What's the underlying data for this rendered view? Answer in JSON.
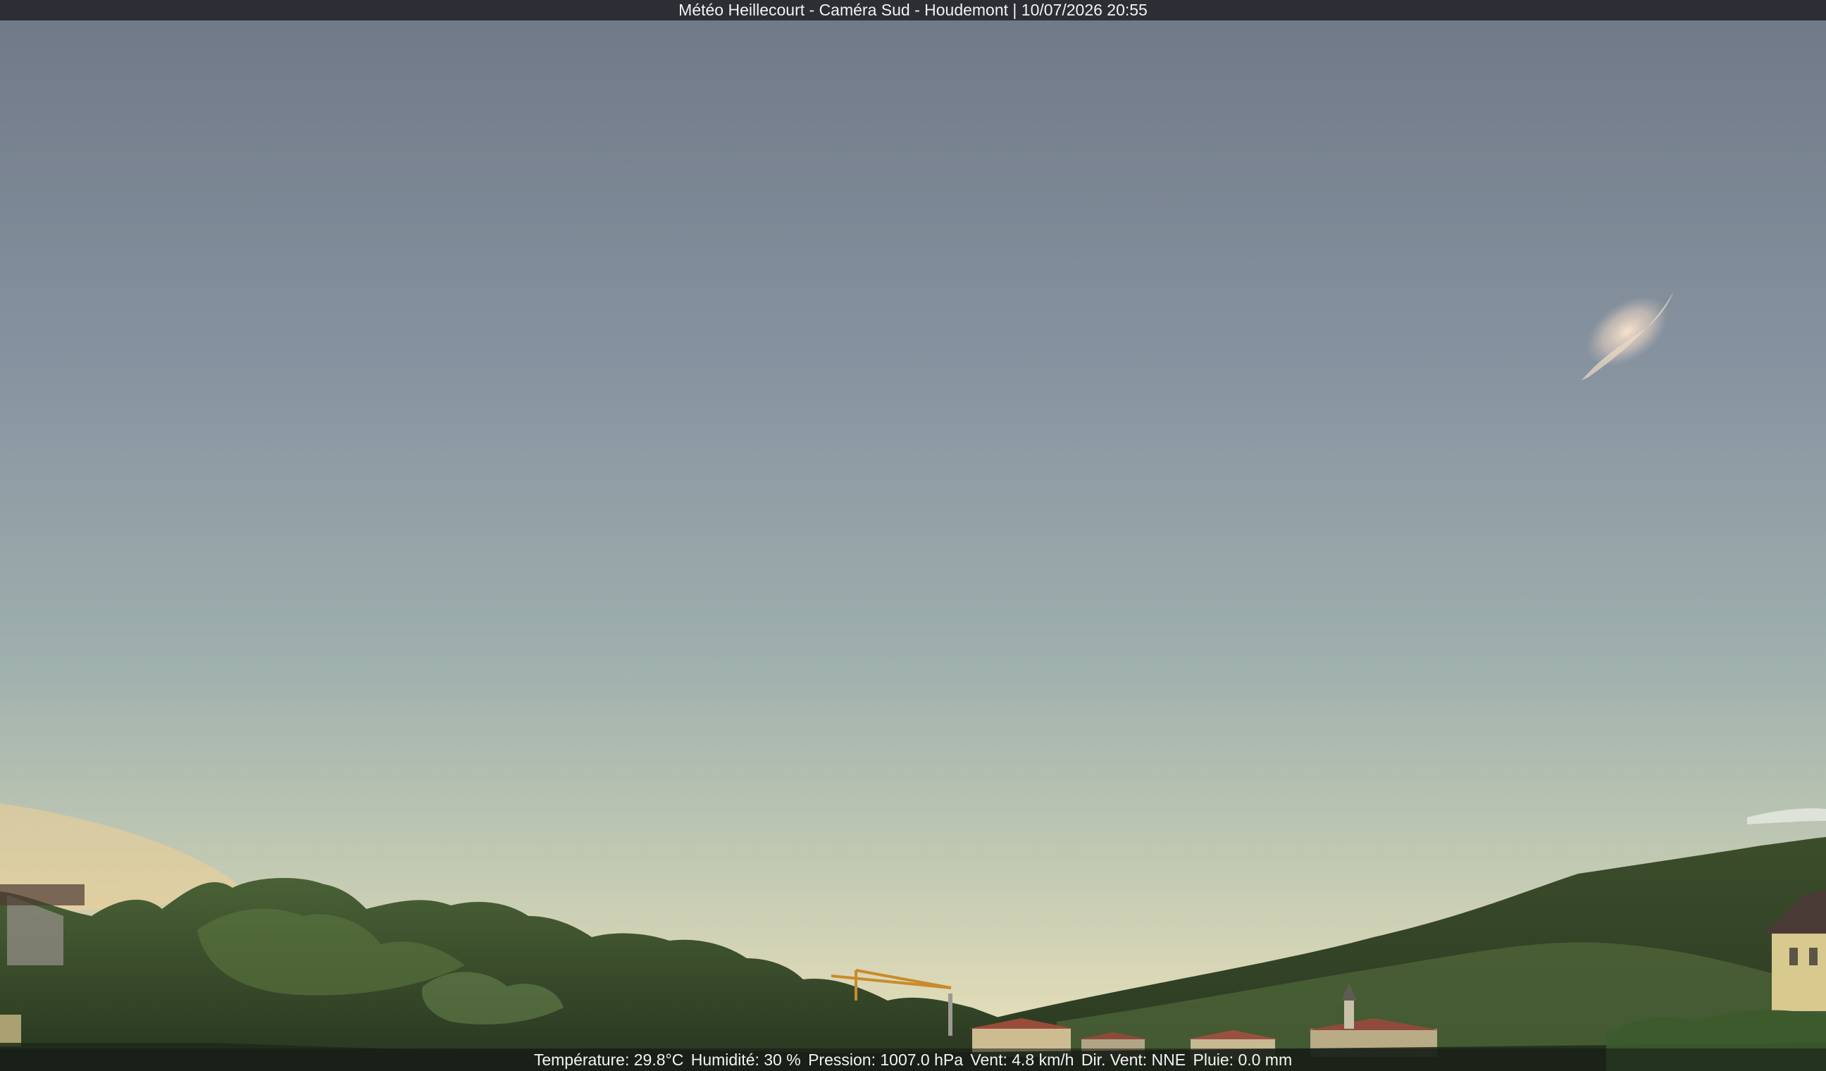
{
  "overlay": {
    "title": "Météo Heillecourt - Caméra Sud - Houdemont | 10/07/2026 20:55"
  },
  "weather": {
    "temperature": "Température: 29.8°C",
    "humidity": "Humidité: 30 %",
    "pressure": "Pression: 1007.0 hPa",
    "wind_speed": "Vent: 4.8 km/h",
    "wind_direction": "Dir. Vent: NNE",
    "rain": "Pluie: 0.0 mm"
  },
  "colors": {
    "sky_top": "#727c8a",
    "sky_mid": "#93a3aa",
    "sky_horizon": "#d6d9b6",
    "glow": "#e9c78f",
    "trees_dark": "#2d3d25",
    "trees_light": "#4f6838"
  }
}
